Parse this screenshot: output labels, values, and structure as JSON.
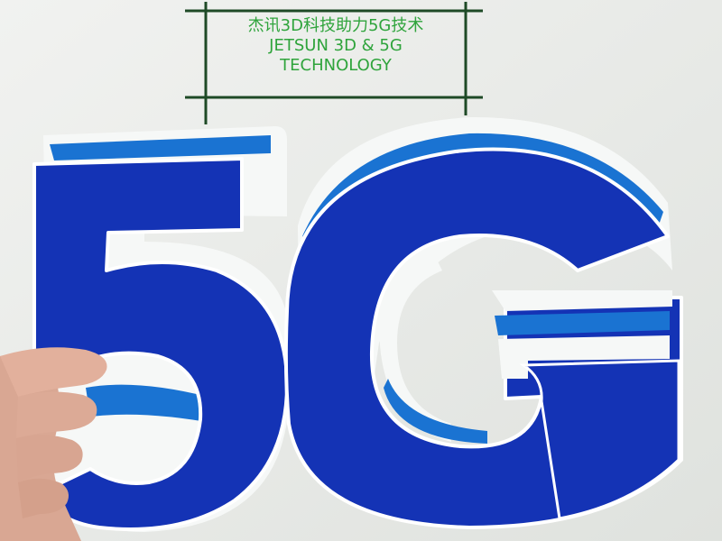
{
  "photo": {
    "subject": "5G",
    "colors": {
      "background": "#e9ebe8",
      "letter_face": "#1433b5",
      "letter_side_white": "#f6f8f7",
      "letter_stripe": "#1a73d2",
      "caption_text": "#2fa43c",
      "frame_lines": "#1e4a26",
      "skin": "#e2b09c"
    }
  },
  "caption": {
    "line_cn": "杰讯3D科技助力5G技术",
    "line_en_1": "JETSUN 3D & 5G",
    "line_en_2": "TECHNOLOGY"
  }
}
